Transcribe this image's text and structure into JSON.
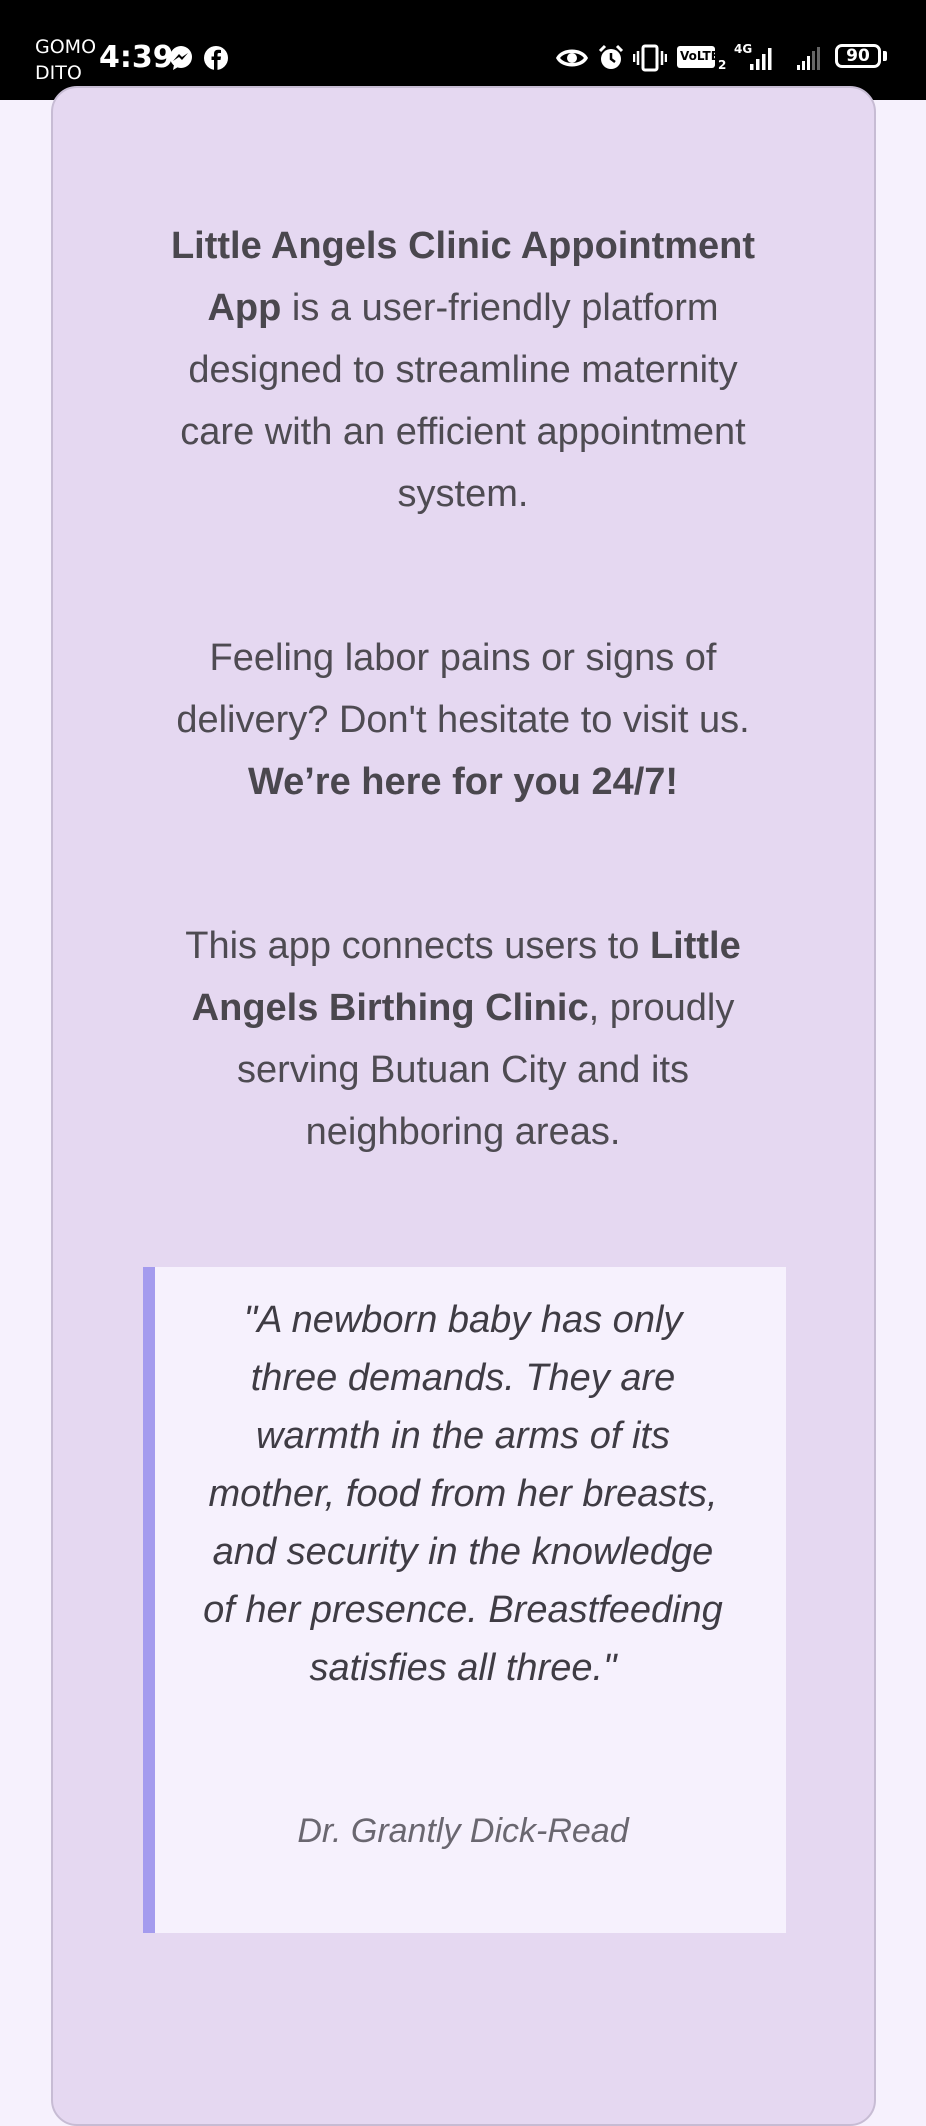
{
  "status_bar": {
    "carrier_line1": "GOMO",
    "carrier_line2": "DITO",
    "time": "4:39",
    "volte_label": "VoLTE",
    "sim_slot": "2",
    "network_type": "4G",
    "battery_level": "90",
    "icons": [
      "messenger-icon",
      "facebook-icon",
      "eye-icon",
      "alarm-icon",
      "vibrate-icon",
      "volte-icon",
      "signal-icon",
      "signal-weak-icon",
      "battery-icon"
    ]
  },
  "intro": {
    "app_name": "Little Angels Clinic Appointment App",
    "description": " is a user-friendly platform designed to streamline maternity care with an efficient appointment system."
  },
  "labor": {
    "text": "Feeling labor pains or signs of delivery? Don't hesitate to visit us.",
    "emphasis": "We’re here for you 24/7!"
  },
  "connect": {
    "prefix": "This app connects users to ",
    "clinic_name": "Little Angels Birthing Clinic",
    "suffix": ", proudly serving Butuan City and its neighboring areas."
  },
  "quote": {
    "text": "\"A newborn baby has only three demands. They are warmth in the arms of its mother, food from her breasts, and security in the knowledge of her presence. Breastfeeding satisfies all three.\"",
    "author": "Dr. Grantly Dick-Read"
  },
  "colors": {
    "card_background": "#e5d8f1",
    "page_background": "#f6f1fd",
    "quote_accent": "#a49bee",
    "text": "#4e4b52"
  }
}
